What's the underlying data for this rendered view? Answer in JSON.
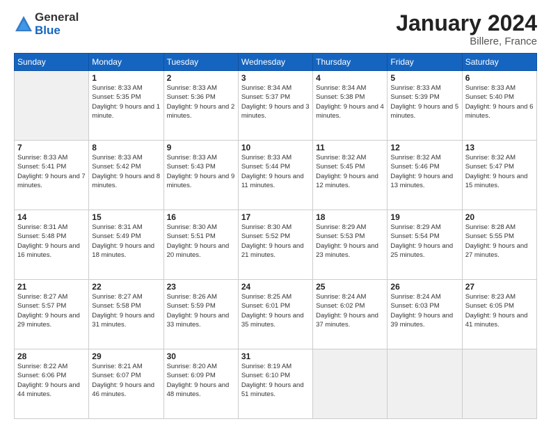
{
  "logo": {
    "general": "General",
    "blue": "Blue"
  },
  "title": {
    "month": "January 2024",
    "location": "Billere, France"
  },
  "headers": [
    "Sunday",
    "Monday",
    "Tuesday",
    "Wednesday",
    "Thursday",
    "Friday",
    "Saturday"
  ],
  "weeks": [
    [
      {
        "day": "",
        "sunrise": "",
        "sunset": "",
        "daylight": ""
      },
      {
        "day": "1",
        "sunrise": "Sunrise: 8:33 AM",
        "sunset": "Sunset: 5:35 PM",
        "daylight": "Daylight: 9 hours and 1 minute."
      },
      {
        "day": "2",
        "sunrise": "Sunrise: 8:33 AM",
        "sunset": "Sunset: 5:36 PM",
        "daylight": "Daylight: 9 hours and 2 minutes."
      },
      {
        "day": "3",
        "sunrise": "Sunrise: 8:34 AM",
        "sunset": "Sunset: 5:37 PM",
        "daylight": "Daylight: 9 hours and 3 minutes."
      },
      {
        "day": "4",
        "sunrise": "Sunrise: 8:34 AM",
        "sunset": "Sunset: 5:38 PM",
        "daylight": "Daylight: 9 hours and 4 minutes."
      },
      {
        "day": "5",
        "sunrise": "Sunrise: 8:33 AM",
        "sunset": "Sunset: 5:39 PM",
        "daylight": "Daylight: 9 hours and 5 minutes."
      },
      {
        "day": "6",
        "sunrise": "Sunrise: 8:33 AM",
        "sunset": "Sunset: 5:40 PM",
        "daylight": "Daylight: 9 hours and 6 minutes."
      }
    ],
    [
      {
        "day": "7",
        "sunrise": "Sunrise: 8:33 AM",
        "sunset": "Sunset: 5:41 PM",
        "daylight": "Daylight: 9 hours and 7 minutes."
      },
      {
        "day": "8",
        "sunrise": "Sunrise: 8:33 AM",
        "sunset": "Sunset: 5:42 PM",
        "daylight": "Daylight: 9 hours and 8 minutes."
      },
      {
        "day": "9",
        "sunrise": "Sunrise: 8:33 AM",
        "sunset": "Sunset: 5:43 PM",
        "daylight": "Daylight: 9 hours and 9 minutes."
      },
      {
        "day": "10",
        "sunrise": "Sunrise: 8:33 AM",
        "sunset": "Sunset: 5:44 PM",
        "daylight": "Daylight: 9 hours and 11 minutes."
      },
      {
        "day": "11",
        "sunrise": "Sunrise: 8:32 AM",
        "sunset": "Sunset: 5:45 PM",
        "daylight": "Daylight: 9 hours and 12 minutes."
      },
      {
        "day": "12",
        "sunrise": "Sunrise: 8:32 AM",
        "sunset": "Sunset: 5:46 PM",
        "daylight": "Daylight: 9 hours and 13 minutes."
      },
      {
        "day": "13",
        "sunrise": "Sunrise: 8:32 AM",
        "sunset": "Sunset: 5:47 PM",
        "daylight": "Daylight: 9 hours and 15 minutes."
      }
    ],
    [
      {
        "day": "14",
        "sunrise": "Sunrise: 8:31 AM",
        "sunset": "Sunset: 5:48 PM",
        "daylight": "Daylight: 9 hours and 16 minutes."
      },
      {
        "day": "15",
        "sunrise": "Sunrise: 8:31 AM",
        "sunset": "Sunset: 5:49 PM",
        "daylight": "Daylight: 9 hours and 18 minutes."
      },
      {
        "day": "16",
        "sunrise": "Sunrise: 8:30 AM",
        "sunset": "Sunset: 5:51 PM",
        "daylight": "Daylight: 9 hours and 20 minutes."
      },
      {
        "day": "17",
        "sunrise": "Sunrise: 8:30 AM",
        "sunset": "Sunset: 5:52 PM",
        "daylight": "Daylight: 9 hours and 21 minutes."
      },
      {
        "day": "18",
        "sunrise": "Sunrise: 8:29 AM",
        "sunset": "Sunset: 5:53 PM",
        "daylight": "Daylight: 9 hours and 23 minutes."
      },
      {
        "day": "19",
        "sunrise": "Sunrise: 8:29 AM",
        "sunset": "Sunset: 5:54 PM",
        "daylight": "Daylight: 9 hours and 25 minutes."
      },
      {
        "day": "20",
        "sunrise": "Sunrise: 8:28 AM",
        "sunset": "Sunset: 5:55 PM",
        "daylight": "Daylight: 9 hours and 27 minutes."
      }
    ],
    [
      {
        "day": "21",
        "sunrise": "Sunrise: 8:27 AM",
        "sunset": "Sunset: 5:57 PM",
        "daylight": "Daylight: 9 hours and 29 minutes."
      },
      {
        "day": "22",
        "sunrise": "Sunrise: 8:27 AM",
        "sunset": "Sunset: 5:58 PM",
        "daylight": "Daylight: 9 hours and 31 minutes."
      },
      {
        "day": "23",
        "sunrise": "Sunrise: 8:26 AM",
        "sunset": "Sunset: 5:59 PM",
        "daylight": "Daylight: 9 hours and 33 minutes."
      },
      {
        "day": "24",
        "sunrise": "Sunrise: 8:25 AM",
        "sunset": "Sunset: 6:01 PM",
        "daylight": "Daylight: 9 hours and 35 minutes."
      },
      {
        "day": "25",
        "sunrise": "Sunrise: 8:24 AM",
        "sunset": "Sunset: 6:02 PM",
        "daylight": "Daylight: 9 hours and 37 minutes."
      },
      {
        "day": "26",
        "sunrise": "Sunrise: 8:24 AM",
        "sunset": "Sunset: 6:03 PM",
        "daylight": "Daylight: 9 hours and 39 minutes."
      },
      {
        "day": "27",
        "sunrise": "Sunrise: 8:23 AM",
        "sunset": "Sunset: 6:05 PM",
        "daylight": "Daylight: 9 hours and 41 minutes."
      }
    ],
    [
      {
        "day": "28",
        "sunrise": "Sunrise: 8:22 AM",
        "sunset": "Sunset: 6:06 PM",
        "daylight": "Daylight: 9 hours and 44 minutes."
      },
      {
        "day": "29",
        "sunrise": "Sunrise: 8:21 AM",
        "sunset": "Sunset: 6:07 PM",
        "daylight": "Daylight: 9 hours and 46 minutes."
      },
      {
        "day": "30",
        "sunrise": "Sunrise: 8:20 AM",
        "sunset": "Sunset: 6:09 PM",
        "daylight": "Daylight: 9 hours and 48 minutes."
      },
      {
        "day": "31",
        "sunrise": "Sunrise: 8:19 AM",
        "sunset": "Sunset: 6:10 PM",
        "daylight": "Daylight: 9 hours and 51 minutes."
      },
      {
        "day": "",
        "sunrise": "",
        "sunset": "",
        "daylight": ""
      },
      {
        "day": "",
        "sunrise": "",
        "sunset": "",
        "daylight": ""
      },
      {
        "day": "",
        "sunrise": "",
        "sunset": "",
        "daylight": ""
      }
    ]
  ]
}
